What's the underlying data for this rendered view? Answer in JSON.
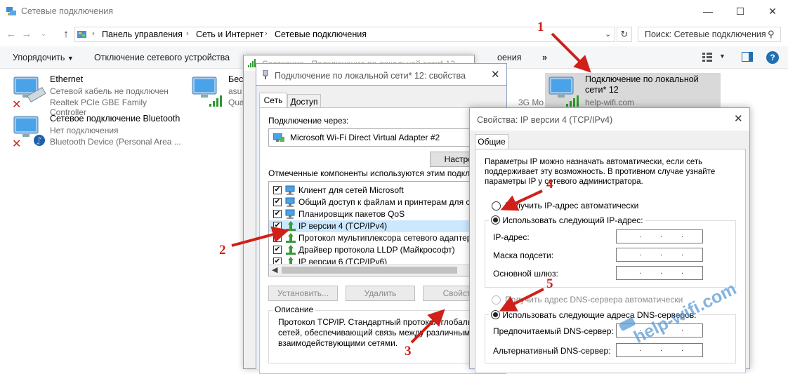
{
  "window": {
    "title": "Сетевые подключения"
  },
  "breadcrumb": [
    "Панель управления",
    "Сеть и Интернет",
    "Сетевые подключения"
  ],
  "search": {
    "placeholder": "Поиск: Сетевые подключения"
  },
  "toolbar": {
    "organize": "Упорядочить",
    "disable_device": "Отключение сетевого устройства",
    "hidden_partial": "оения",
    "more": "»"
  },
  "connections": [
    {
      "name": "Ethernet",
      "status": "Сетевой кабель не подключен",
      "device": "Realtek PCIe GBE Family Controller"
    },
    {
      "name": "Сетевое подключение Bluetooth",
      "status": "Нет подключения",
      "device": "Bluetooth Device (Personal Area ..."
    },
    {
      "name": "Бес",
      "status": "asu",
      "device": "Qua"
    },
    {
      "name": "Подключение по локальной сети* 12",
      "status": "help-wifi.com",
      "device": ""
    }
  ],
  "partial_texts": {
    "g_mo": "3G Mo"
  },
  "status_dialog": {
    "title": "Состояние - Подключение по локальной сети* 12"
  },
  "props_dialog": {
    "title": "Подключение по локальной сети* 12: свойства",
    "tabs": [
      "Сеть",
      "Доступ"
    ],
    "connect_via_label": "Подключение через:",
    "adapter": "Microsoft Wi-Fi Direct Virtual Adapter #2",
    "configure": "Настроить",
    "components_label": "Отмеченные компоненты используются этим подключением:",
    "components": [
      {
        "label": "Клиент для сетей Microsoft",
        "checked": true
      },
      {
        "label": "Общий доступ к файлам и принтерам для сетей Microsoft",
        "checked": true
      },
      {
        "label": "Планировщик пакетов QoS",
        "checked": true
      },
      {
        "label": "IP версии 4 (TCP/IPv4)",
        "checked": true
      },
      {
        "label": "Протокол мультиплексора сетевого адаптера (Майкрософт)",
        "checked": false
      },
      {
        "label": "Драйвер протокола LLDP (Майкрософт)",
        "checked": true
      },
      {
        "label": "IP версии 6 (TCP/IPv6)",
        "checked": true
      }
    ],
    "install": "Установить...",
    "uninstall": "Удалить",
    "properties": "Свойства",
    "description_label": "Описание",
    "description": [
      "Протокол TCP/IP. Стандартный протокол глобальных",
      "сетей, обеспечивающий связь между различными",
      "взаимодействующими сетями."
    ]
  },
  "ipv4_dialog": {
    "title": "Свойства: IP версии 4 (TCP/IPv4)",
    "tab": "Общие",
    "intro": [
      "Параметры IP можно назначать автоматически, если сеть",
      "поддерживает эту возможность. В противном случае узнайте",
      "параметры IP у сетевого администратора."
    ],
    "auto_ip": "Получить IP-адрес автоматически",
    "manual_ip": "Использовать следующий IP-адрес:",
    "ip_label": "IP-адрес:",
    "mask_label": "Маска подсети:",
    "gateway_label": "Основной шлюз:",
    "auto_dns": "Получить адрес DNS-сервера автоматически",
    "manual_dns": "Использовать следующие адреса DNS-серверов:",
    "preferred_dns_label": "Предпочитаемый DNS-сервер:",
    "alternate_dns_label": "Альтернативный DNS-сервер:",
    "selected_ip_mode": "manual",
    "selected_dns_mode": "manual"
  },
  "annotations": {
    "n1": "1",
    "n2": "2",
    "n3": "3",
    "n4": "4",
    "n5": "5"
  },
  "watermark": "help-wifi.com",
  "colors": {
    "arrow": "#d0201a",
    "watermark": "#5b9bd5",
    "selection": "#cce8ff"
  }
}
